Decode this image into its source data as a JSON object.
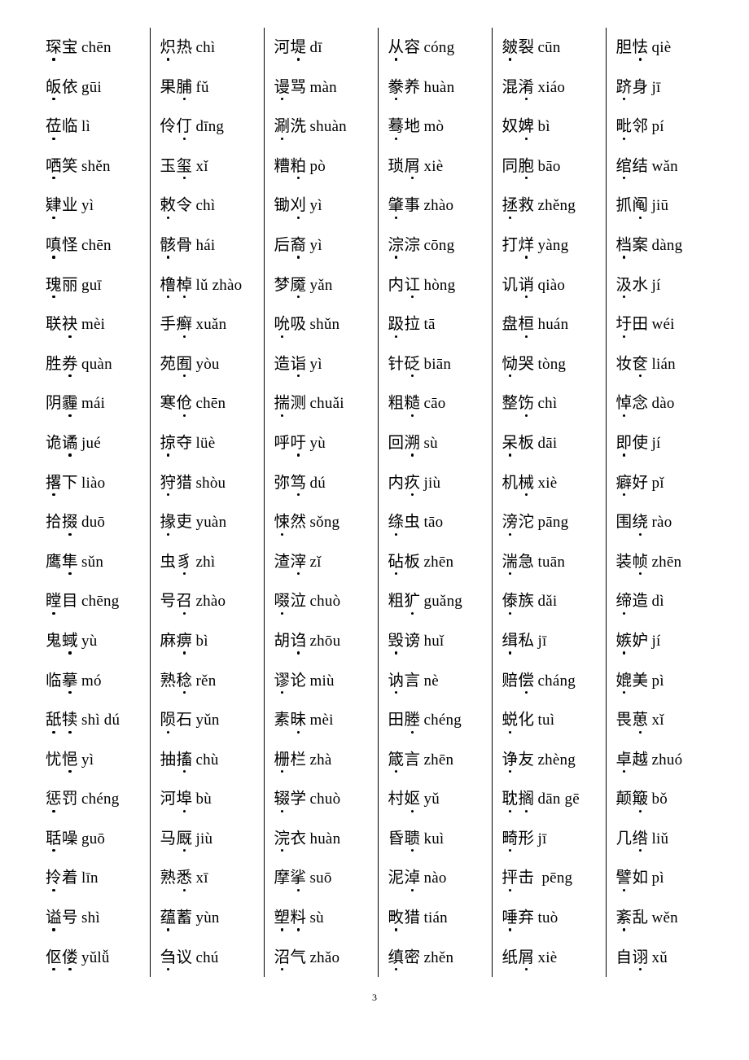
{
  "document": {
    "page_number": "3",
    "column_count": 6,
    "row_count": 24
  },
  "columns": [
    {
      "index": 1,
      "entries": [
        {
          "word": "琛宝",
          "dots": [
            0
          ],
          "pinyin": "chēn"
        },
        {
          "word": "皈依",
          "dots": [
            0
          ],
          "pinyin": "gūi"
        },
        {
          "word": "莅临",
          "dots": [
            0
          ],
          "pinyin": "lì"
        },
        {
          "word": "哂笑",
          "dots": [
            0
          ],
          "pinyin": "shěn"
        },
        {
          "word": "肄业",
          "dots": [
            0
          ],
          "pinyin": "yì"
        },
        {
          "word": "嗔怪",
          "dots": [
            0
          ],
          "pinyin": "chēn"
        },
        {
          "word": "瑰丽",
          "dots": [
            0
          ],
          "pinyin": "guī"
        },
        {
          "word": "联袂",
          "dots": [
            1
          ],
          "pinyin": "mèi"
        },
        {
          "word": "胜券",
          "dots": [
            1
          ],
          "pinyin": "quàn"
        },
        {
          "word": "阴霾",
          "dots": [
            1
          ],
          "pinyin": "mái"
        },
        {
          "word": "诡谲",
          "dots": [
            1
          ],
          "pinyin": "jué"
        },
        {
          "word": "撂下",
          "dots": [
            0
          ],
          "pinyin": "liào"
        },
        {
          "word": "拾掇",
          "dots": [
            1
          ],
          "pinyin": "duō"
        },
        {
          "word": "鹰隼",
          "dots": [
            1
          ],
          "pinyin": "sǔn"
        },
        {
          "word": "瞠目",
          "dots": [
            0
          ],
          "pinyin": "chēng"
        },
        {
          "word": "鬼蜮",
          "dots": [
            1
          ],
          "pinyin": "yù"
        },
        {
          "word": "临摹",
          "dots": [
            1
          ],
          "pinyin": "mó"
        },
        {
          "word": "舐犊",
          "dots": [
            0,
            1
          ],
          "pinyin": "shì dú"
        },
        {
          "word": "忧悒",
          "dots": [
            1
          ],
          "pinyin": "yì"
        },
        {
          "word": "惩罚",
          "dots": [
            0
          ],
          "pinyin": "chéng"
        },
        {
          "word": "聒噪",
          "dots": [
            0
          ],
          "pinyin": "guō"
        },
        {
          "word": "拎着",
          "dots": [
            0
          ],
          "pinyin": "līn"
        },
        {
          "word": "谥号",
          "dots": [
            0
          ],
          "pinyin": "shì"
        },
        {
          "word": "伛偻",
          "dots": [
            0,
            1
          ],
          "pinyin": "yǔlǚ"
        }
      ]
    },
    {
      "index": 2,
      "entries": [
        {
          "word": "炽热",
          "dots": [
            0
          ],
          "pinyin": "chì"
        },
        {
          "word": "果脯",
          "dots": [
            1
          ],
          "pinyin": "fǔ"
        },
        {
          "word": "伶仃",
          "dots": [
            1
          ],
          "pinyin": "dīng"
        },
        {
          "word": "玉玺",
          "dots": [
            1
          ],
          "pinyin": "xǐ"
        },
        {
          "word": "敕令",
          "dots": [
            0
          ],
          "pinyin": "chì"
        },
        {
          "word": "骸骨",
          "dots": [
            0
          ],
          "pinyin": "hái"
        },
        {
          "word": "橹棹",
          "dots": [
            0,
            1
          ],
          "pinyin": "lǔ zhào"
        },
        {
          "word": "手癣",
          "dots": [
            1
          ],
          "pinyin": "xuǎn"
        },
        {
          "word": "苑囿",
          "dots": [
            1
          ],
          "pinyin": "yòu"
        },
        {
          "word": "寒伧",
          "dots": [
            1
          ],
          "pinyin": "chēn"
        },
        {
          "word": "掠夺",
          "dots": [
            0
          ],
          "pinyin": "lüè"
        },
        {
          "word": "狩猎",
          "dots": [
            0
          ],
          "pinyin": "shòu"
        },
        {
          "word": "掾吏",
          "dots": [
            0
          ],
          "pinyin": "yuàn"
        },
        {
          "word": "虫豸",
          "dots": [
            1
          ],
          "pinyin": "zhì"
        },
        {
          "word": "号召",
          "dots": [
            1
          ],
          "pinyin": "zhào"
        },
        {
          "word": "麻痹",
          "dots": [
            1
          ],
          "pinyin": "bì"
        },
        {
          "word": "熟稔",
          "dots": [
            1
          ],
          "pinyin": "rěn"
        },
        {
          "word": "陨石",
          "dots": [
            0
          ],
          "pinyin": "yǔn"
        },
        {
          "word": "抽搐",
          "dots": [
            1
          ],
          "pinyin": "chù"
        },
        {
          "word": "河埠",
          "dots": [
            1
          ],
          "pinyin": "bù"
        },
        {
          "word": "马厩",
          "dots": [
            1
          ],
          "pinyin": "jiù"
        },
        {
          "word": "熟悉",
          "dots": [
            1
          ],
          "pinyin": "xī"
        },
        {
          "word": "蕴蓄",
          "dots": [
            0
          ],
          "pinyin": "yùn"
        },
        {
          "word": "刍议",
          "dots": [
            0
          ],
          "pinyin": "chú"
        }
      ]
    },
    {
      "index": 3,
      "entries": [
        {
          "word": "河堤",
          "dots": [
            1
          ],
          "pinyin": "dī"
        },
        {
          "word": "谩骂",
          "dots": [
            0
          ],
          "pinyin": "màn"
        },
        {
          "word": "涮洗",
          "dots": [
            0
          ],
          "pinyin": "shuàn"
        },
        {
          "word": "糟粕",
          "dots": [
            1
          ],
          "pinyin": "pò"
        },
        {
          "word": "锄刈",
          "dots": [
            1
          ],
          "pinyin": "yì"
        },
        {
          "word": "后裔",
          "dots": [
            1
          ],
          "pinyin": "yì"
        },
        {
          "word": "梦魇",
          "dots": [
            1
          ],
          "pinyin": "yǎn"
        },
        {
          "word": "吮吸",
          "dots": [
            0
          ],
          "pinyin": "shǔn"
        },
        {
          "word": "造诣",
          "dots": [
            1
          ],
          "pinyin": "yì"
        },
        {
          "word": "揣测",
          "dots": [
            0
          ],
          "pinyin": "chuǎi"
        },
        {
          "word": "呼吁",
          "dots": [
            1
          ],
          "pinyin": "yù"
        },
        {
          "word": "弥笃",
          "dots": [
            1
          ],
          "pinyin": "dú"
        },
        {
          "word": "悚然",
          "dots": [
            0
          ],
          "pinyin": "sǒng"
        },
        {
          "word": "渣滓",
          "dots": [
            1
          ],
          "pinyin": "zǐ"
        },
        {
          "word": "啜泣",
          "dots": [
            0
          ],
          "pinyin": "chuò"
        },
        {
          "word": "胡诌",
          "dots": [
            1
          ],
          "pinyin": "zhōu"
        },
        {
          "word": "谬论",
          "dots": [
            0
          ],
          "pinyin": "miù"
        },
        {
          "word": "素昧",
          "dots": [
            1
          ],
          "pinyin": "mèi"
        },
        {
          "word": "栅栏",
          "dots": [
            0
          ],
          "pinyin": "zhà"
        },
        {
          "word": "辍学",
          "dots": [
            0
          ],
          "pinyin": "chuò"
        },
        {
          "word": "浣衣",
          "dots": [
            0
          ],
          "pinyin": "huàn"
        },
        {
          "word": "摩挲",
          "dots": [
            1
          ],
          "pinyin": "suō"
        },
        {
          "word": "塑料",
          "dots": [
            0,
            1
          ],
          "pinyin": "sù"
        },
        {
          "word": "沼气",
          "dots": [
            0
          ],
          "pinyin": "zhǎo"
        }
      ]
    },
    {
      "index": 4,
      "entries": [
        {
          "word": "从容",
          "dots": [
            0
          ],
          "pinyin": "cóng"
        },
        {
          "word": "豢养",
          "dots": [
            0
          ],
          "pinyin": "huàn"
        },
        {
          "word": "蓦地",
          "dots": [
            0
          ],
          "pinyin": "mò"
        },
        {
          "word": "琐屑",
          "dots": [
            1
          ],
          "pinyin": "xiè"
        },
        {
          "word": "肇事",
          "dots": [
            0
          ],
          "pinyin": "zhào"
        },
        {
          "word": "淙淙",
          "dots": [
            0
          ],
          "pinyin": "cōng"
        },
        {
          "word": "内讧",
          "dots": [
            1
          ],
          "pinyin": "hòng"
        },
        {
          "word": "趿拉",
          "dots": [
            0
          ],
          "pinyin": "tā"
        },
        {
          "word": "针砭",
          "dots": [
            1
          ],
          "pinyin": "biān"
        },
        {
          "word": "粗糙",
          "dots": [
            1
          ],
          "pinyin": "cāo"
        },
        {
          "word": "回溯",
          "dots": [
            1
          ],
          "pinyin": "sù"
        },
        {
          "word": "内疚",
          "dots": [
            1
          ],
          "pinyin": "jiù"
        },
        {
          "word": "绦虫",
          "dots": [
            0
          ],
          "pinyin": "tāo"
        },
        {
          "word": "砧板",
          "dots": [
            0
          ],
          "pinyin": "zhēn"
        },
        {
          "word": "粗犷",
          "dots": [
            1
          ],
          "pinyin": "guǎng"
        },
        {
          "word": "毁谤",
          "dots": [
            0
          ],
          "pinyin": "huǐ"
        },
        {
          "word": "讷言",
          "dots": [
            0
          ],
          "pinyin": "nè"
        },
        {
          "word": "田塍",
          "dots": [
            1
          ],
          "pinyin": "chéng"
        },
        {
          "word": "箴言",
          "dots": [
            0
          ],
          "pinyin": "zhēn"
        },
        {
          "word": "村妪",
          "dots": [
            1
          ],
          "pinyin": "yǔ"
        },
        {
          "word": "昏聩",
          "dots": [
            1
          ],
          "pinyin": "kuì"
        },
        {
          "word": "泥淖",
          "dots": [
            1
          ],
          "pinyin": "nào"
        },
        {
          "word": "畋猎",
          "dots": [
            0
          ],
          "pinyin": "tián"
        },
        {
          "word": "缜密",
          "dots": [
            0
          ],
          "pinyin": "zhěn"
        }
      ]
    },
    {
      "index": 5,
      "entries": [
        {
          "word": "皴裂",
          "dots": [
            0
          ],
          "pinyin": "cūn"
        },
        {
          "word": "混淆",
          "dots": [
            1
          ],
          "pinyin": "xiáo"
        },
        {
          "word": "奴婢",
          "dots": [
            1
          ],
          "pinyin": "bì"
        },
        {
          "word": "同胞",
          "dots": [
            1
          ],
          "pinyin": "bāo"
        },
        {
          "word": "拯救",
          "dots": [
            0
          ],
          "pinyin": "zhěng"
        },
        {
          "word": "打烊",
          "dots": [
            1
          ],
          "pinyin": "yàng"
        },
        {
          "word": "讥诮",
          "dots": [
            1
          ],
          "pinyin": "qiào"
        },
        {
          "word": "盘桓",
          "dots": [
            1
          ],
          "pinyin": "huán"
        },
        {
          "word": "恸哭",
          "dots": [
            0
          ],
          "pinyin": "tòng"
        },
        {
          "word": "整饬",
          "dots": [
            1
          ],
          "pinyin": "chì"
        },
        {
          "word": "呆板",
          "dots": [
            0
          ],
          "pinyin": "dāi"
        },
        {
          "word": "机械",
          "dots": [
            1
          ],
          "pinyin": "xiè"
        },
        {
          "word": "滂沱",
          "dots": [
            0
          ],
          "pinyin": "pāng"
        },
        {
          "word": "湍急",
          "dots": [
            0
          ],
          "pinyin": "tuān"
        },
        {
          "word": "傣族",
          "dots": [
            0
          ],
          "pinyin": "dǎi"
        },
        {
          "word": "缉私",
          "dots": [
            0
          ],
          "pinyin": "jī"
        },
        {
          "word": "赔偿",
          "dots": [
            1
          ],
          "pinyin": "cháng"
        },
        {
          "word": "蜕化",
          "dots": [
            0
          ],
          "pinyin": "tuì"
        },
        {
          "word": "诤友",
          "dots": [
            0
          ],
          "pinyin": "zhèng"
        },
        {
          "word": "耽搁",
          "dots": [
            0,
            1
          ],
          "pinyin": "dān gē"
        },
        {
          "word": "畸形",
          "dots": [
            0
          ],
          "pinyin": "jī"
        },
        {
          "word": "抨击",
          "dots": [
            0
          ],
          "pinyin": " pēng"
        },
        {
          "word": "唾弃",
          "dots": [
            0
          ],
          "pinyin": "tuò"
        },
        {
          "word": "纸屑",
          "dots": [
            1
          ],
          "pinyin": "xiè"
        }
      ]
    },
    {
      "index": 6,
      "entries": [
        {
          "word": "胆怯",
          "dots": [
            1
          ],
          "pinyin": "qiè"
        },
        {
          "word": "跻身",
          "dots": [
            0
          ],
          "pinyin": "jī"
        },
        {
          "word": "毗邻",
          "dots": [
            0
          ],
          "pinyin": "pí"
        },
        {
          "word": "绾结",
          "dots": [
            0
          ],
          "pinyin": "wǎn"
        },
        {
          "word": "抓阄",
          "dots": [
            1
          ],
          "pinyin": "jiū"
        },
        {
          "word": "档案",
          "dots": [
            0
          ],
          "pinyin": "dàng"
        },
        {
          "word": "汲水",
          "dots": [
            0
          ],
          "pinyin": "jí"
        },
        {
          "word": "圩田",
          "dots": [
            0
          ],
          "pinyin": "wéi"
        },
        {
          "word": "妆奁",
          "dots": [
            1
          ],
          "pinyin": "lián"
        },
        {
          "word": "悼念",
          "dots": [
            0
          ],
          "pinyin": "dào"
        },
        {
          "word": "即使",
          "dots": [
            0
          ],
          "pinyin": "jí"
        },
        {
          "word": "癖好",
          "dots": [
            0
          ],
          "pinyin": "pǐ"
        },
        {
          "word": "围绕",
          "dots": [
            1
          ],
          "pinyin": "rào"
        },
        {
          "word": "装帧",
          "dots": [
            1
          ],
          "pinyin": "zhēn"
        },
        {
          "word": "缔造",
          "dots": [
            0
          ],
          "pinyin": "dì"
        },
        {
          "word": "嫉妒",
          "dots": [
            0
          ],
          "pinyin": "jí"
        },
        {
          "word": "媲美",
          "dots": [
            0
          ],
          "pinyin": "pì"
        },
        {
          "word": "畏葸",
          "dots": [
            1
          ],
          "pinyin": "xǐ"
        },
        {
          "word": "卓越",
          "dots": [
            0
          ],
          "pinyin": "zhuó"
        },
        {
          "word": "颠簸",
          "dots": [
            1
          ],
          "pinyin": "bǒ"
        },
        {
          "word": "几绺",
          "dots": [
            1
          ],
          "pinyin": "liǔ"
        },
        {
          "word": "譬如",
          "dots": [
            0
          ],
          "pinyin": "pì"
        },
        {
          "word": "紊乱",
          "dots": [
            0
          ],
          "pinyin": "wěn"
        },
        {
          "word": "自诩",
          "dots": [
            1
          ],
          "pinyin": "xǔ"
        }
      ]
    }
  ]
}
